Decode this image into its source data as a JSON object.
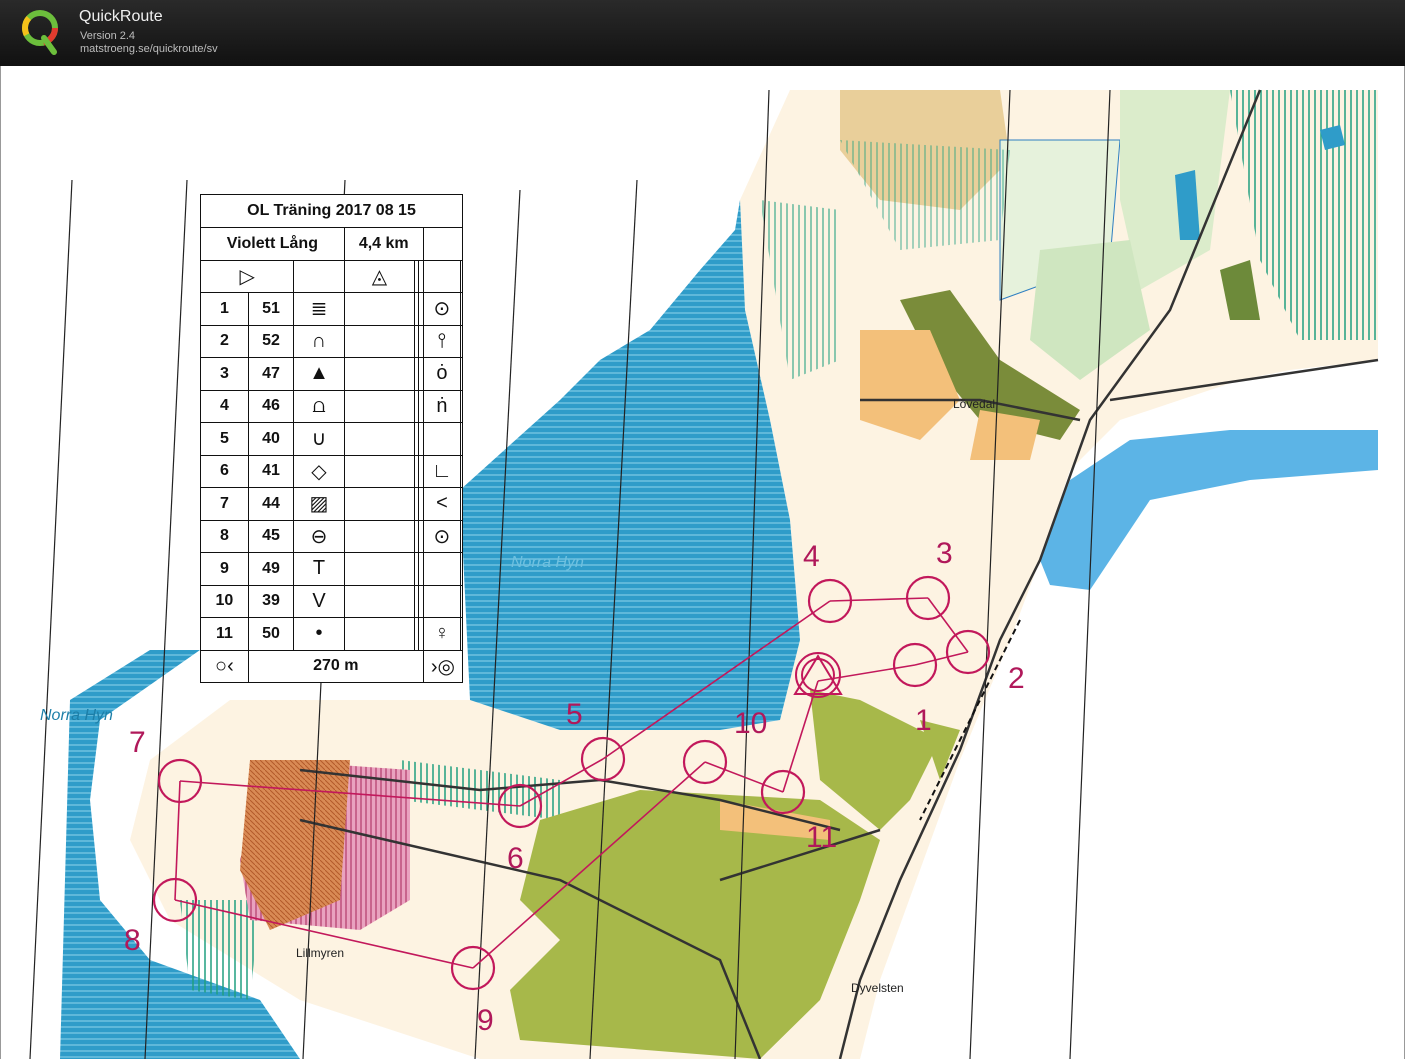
{
  "app": {
    "name": "QuickRoute",
    "version": "Version 2.4",
    "url": "matstroeng.se/quickroute/sv"
  },
  "course": {
    "title": "OL Träning 2017 08 15",
    "class_name": "Violett Lång",
    "length": "4,4 km",
    "finish_distance": "270 m",
    "controls": [
      {
        "num": "1",
        "code": "51",
        "feature_icon": "terrace-icon",
        "detail_icon": "top-side-icon"
      },
      {
        "num": "2",
        "code": "52",
        "feature_icon": "spur-icon",
        "detail_icon": "foot-east-icon"
      },
      {
        "num": "3",
        "code": "47",
        "feature_icon": "boulder-icon",
        "detail_icon": "top-icon"
      },
      {
        "num": "4",
        "code": "46",
        "feature_icon": "fence-icon",
        "detail_icon": "foot-icon"
      },
      {
        "num": "5",
        "code": "40",
        "feature_icon": "reentrant-icon",
        "detail_icon": ""
      },
      {
        "num": "6",
        "code": "41",
        "feature_icon": "depression-icon",
        "detail_icon": "corner-icon"
      },
      {
        "num": "7",
        "code": "44",
        "feature_icon": "ruin-icon",
        "detail_icon": "angle-icon"
      },
      {
        "num": "8",
        "code": "45",
        "feature_icon": "cave-icon",
        "detail_icon": "centre-icon"
      },
      {
        "num": "9",
        "code": "49",
        "feature_icon": "single-tree-icon",
        "detail_icon": ""
      },
      {
        "num": "10",
        "code": "39",
        "feature_icon": "gully-icon",
        "detail_icon": ""
      },
      {
        "num": "11",
        "code": "50",
        "feature_icon": "knoll-icon",
        "detail_icon": "bottom-icon"
      }
    ]
  },
  "map": {
    "place_names": {
      "norra_hyn_left": "Norra Hyn",
      "norra_hyn_lake": "Norra Hyn",
      "lovedal": "Lövedal",
      "lillmyren": "Lillmyren",
      "dyvelsten": "Dyvelsten"
    },
    "control_labels": [
      "1",
      "2",
      "3",
      "4",
      "5",
      "6",
      "7",
      "8",
      "9",
      "10",
      "11"
    ],
    "colors": {
      "course": "#c2185b",
      "water": "#3aa0c8",
      "open_land": "#f3c07a",
      "vegetation": "#9bc46a",
      "building": "#6d7a3a",
      "marsh": "#2a9d8f"
    }
  }
}
